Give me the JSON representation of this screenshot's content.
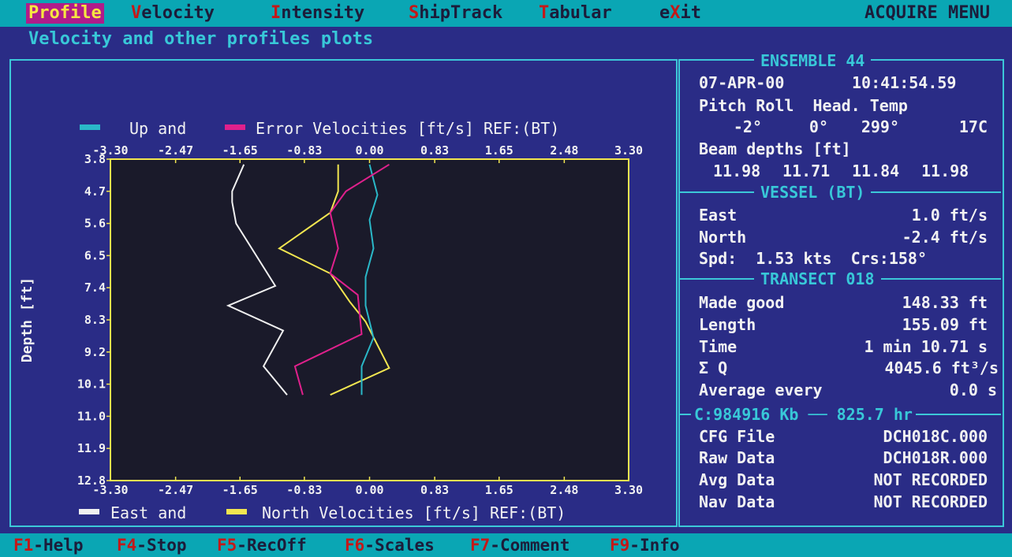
{
  "menu": {
    "items": [
      {
        "hotkey": "P",
        "rest": "rofile"
      },
      {
        "hotkey": "V",
        "rest": "elocity"
      },
      {
        "hotkey": "I",
        "rest": "ntensity"
      },
      {
        "hotkey": "S",
        "rest": "hipTrack"
      },
      {
        "hotkey": "T",
        "rest": "abular"
      },
      {
        "pre": "e",
        "hotkey": "X",
        "rest": "it"
      }
    ],
    "title": "ACQUIRE MENU"
  },
  "subtitle": "Velocity and other profiles plots",
  "plot": {
    "top_legend_a": "Up and",
    "top_legend_b": "Error Velocities [ft/s] REF:(BT)",
    "bottom_legend_a": "East and",
    "bottom_legend_b": "North Velocities [ft/s] REF:(BT)",
    "ylabel": "Depth [ft]",
    "colors": {
      "up": "#2ab8c8",
      "error": "#e0208c",
      "east": "#f0f0f0",
      "north": "#f2e650",
      "axes": "#f2e650",
      "bg": "#1a1a2a"
    }
  },
  "chart_data": {
    "type": "line",
    "xlabel": "Velocities [ft/s]",
    "ylabel": "Depth [ft]",
    "xlim": [
      -3.3,
      3.3
    ],
    "ylim": [
      3.8,
      12.8
    ],
    "xticks": [
      "-3.30",
      "-2.47",
      "-1.65",
      "-0.83",
      "0.00",
      "0.83",
      "1.65",
      "2.48",
      "3.30"
    ],
    "yticks": [
      "3.8",
      "4.7",
      "5.6",
      "6.5",
      "7.4",
      "8.3",
      "9.2",
      "10.1",
      "11.0",
      "11.9",
      "12.8"
    ],
    "series": [
      {
        "name": "East",
        "x": [
          -1.6,
          -1.75,
          -1.75,
          -1.7,
          -1.2,
          -1.8,
          -1.1,
          -1.35,
          -1.05
        ],
        "y": [
          3.95,
          4.7,
          5.0,
          5.6,
          7.35,
          7.9,
          8.6,
          9.6,
          10.4
        ]
      },
      {
        "name": "North",
        "x": [
          -0.4,
          -0.4,
          -0.5,
          -1.15,
          -0.5,
          -0.25,
          -0.05,
          0.25,
          -0.5
        ],
        "y": [
          3.95,
          4.7,
          5.3,
          6.3,
          7.0,
          7.8,
          8.35,
          9.65,
          10.4
        ]
      },
      {
        "name": "Up",
        "x": [
          0.0,
          0.1,
          0.0,
          0.05,
          -0.05,
          -0.05,
          0.05,
          -0.1,
          -0.1
        ],
        "y": [
          3.95,
          4.8,
          5.5,
          6.3,
          7.1,
          7.9,
          8.8,
          9.6,
          10.4
        ]
      },
      {
        "name": "Error",
        "x": [
          0.25,
          -0.3,
          -0.5,
          -0.4,
          -0.5,
          -0.15,
          -0.1,
          -0.95,
          -0.85
        ],
        "y": [
          3.95,
          4.7,
          5.3,
          6.3,
          7.0,
          7.6,
          8.7,
          9.6,
          10.4
        ]
      }
    ]
  },
  "ensemble": {
    "title": "ENSEMBLE 44",
    "date": "07-APR-00",
    "time": "10:41:54.59",
    "headers": "Pitch Roll  Head. Temp",
    "pitch": "-2°",
    "roll": "0°",
    "heading": "299°",
    "temp": "17C",
    "beam_label": "Beam depths [ft]",
    "beams": [
      "11.98",
      "11.71",
      "11.84",
      "11.98"
    ]
  },
  "vessel": {
    "title": "VESSEL (BT)",
    "east_label": "East",
    "east_value": "1.0 ft/s",
    "north_label": "North",
    "north_value": "-2.4 ft/s",
    "speed_line": "Spd:  1.53 kts  Crs:158°"
  },
  "transect": {
    "title": "TRANSECT 018",
    "made_good_label": "Made good",
    "made_good_value": "148.33 ft",
    "length_label": "Length",
    "length_value": "155.09 ft",
    "time_label": "Time",
    "time_value": "1 min 10.71 s",
    "q_label": "Σ Q",
    "q_value": "4045.6 ft³/s",
    "avg_label": "Average every",
    "avg_value": "0.0 s"
  },
  "status": {
    "memory": "C:984916 Kb",
    "hours": "825.7 hr",
    "cfg_label": "CFG File",
    "cfg_value": "DCH018C.000",
    "raw_label": "Raw Data",
    "raw_value": "DCH018R.000",
    "avg_label": "Avg Data",
    "avg_value": "NOT RECORDED",
    "nav_label": "Nav Data",
    "nav_value": "NOT RECORDED"
  },
  "fkeys": [
    {
      "key": "F1",
      "label": "-Help"
    },
    {
      "key": "F4",
      "label": "-Stop"
    },
    {
      "key": "F5",
      "label": "-RecOff"
    },
    {
      "key": "F6",
      "label": "-Scales"
    },
    {
      "key": "F7",
      "label": "-Comment"
    },
    {
      "key": "F9",
      "label": "-Info"
    }
  ]
}
